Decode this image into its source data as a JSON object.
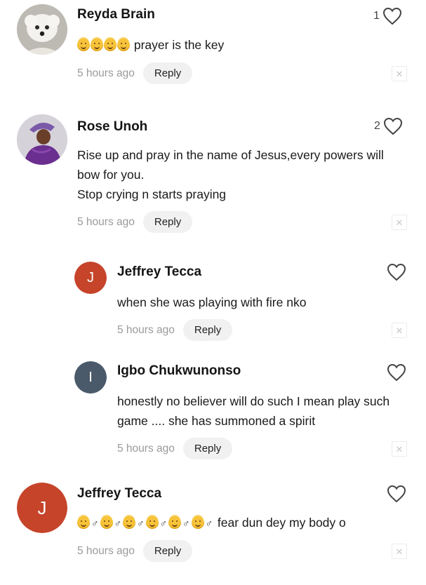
{
  "comments": [
    {
      "name": "Reyda Brain",
      "avatar_kind": "dog-photo",
      "text_suffix": "prayer is the key",
      "emoji_count": 4,
      "time": "5 hours ago",
      "reply_label": "Reply",
      "like_count": "1"
    },
    {
      "name": "Rose Unoh",
      "avatar_kind": "person-photo",
      "lines": [
        "Rise up and pray in the name of Jesus,every powers will",
        "bow for you.",
        "Stop crying n starts praying"
      ],
      "time": "5 hours ago",
      "reply_label": "Reply",
      "like_count": "2"
    },
    {
      "name": "Jeffrey Tecca",
      "avatar_letter": "J",
      "avatar_color": "#c5442a",
      "lines": [
        "when she was playing with fire nko"
      ],
      "time": "5 hours ago",
      "reply_label": "Reply",
      "like_count": ""
    },
    {
      "name": "Igbo Chukwunonso",
      "avatar_letter": "I",
      "avatar_color": "#4a5a6a",
      "lines": [
        "honestly no believer will do such I mean play such",
        "game .... she has summoned a spirit"
      ],
      "time": "5 hours ago",
      "reply_label": "Reply",
      "like_count": ""
    },
    {
      "name": "Jeffrey Tecca",
      "avatar_letter": "J",
      "avatar_color": "#c5442a",
      "text_suffix": "fear dun dey my body o",
      "male_symbol": "♂",
      "time": "5 hours ago",
      "reply_label": "Reply",
      "like_count": ""
    }
  ],
  "icons": {
    "like": "heart-outline-icon",
    "close": "close-icon",
    "close_glyph": "✕"
  },
  "colors": {
    "time": "#9a9a9a",
    "reply_bg": "#f1f1f1",
    "heart_stroke": "#444444"
  }
}
